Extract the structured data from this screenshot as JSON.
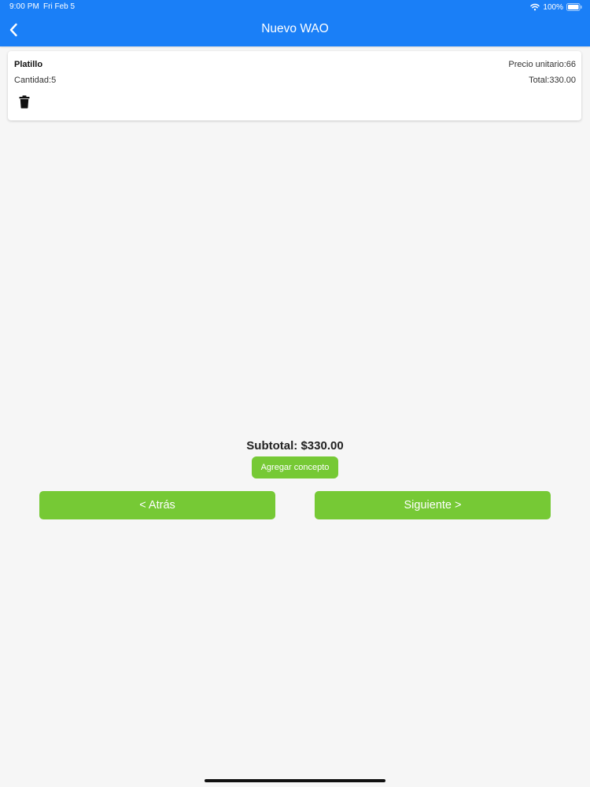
{
  "status_bar": {
    "time": "9:00 PM",
    "date": "Fri Feb 5",
    "battery": "100%",
    "icons": [
      "wifi-icon",
      "battery-icon"
    ]
  },
  "nav": {
    "title": "Nuevo WAO",
    "back_icon": "chevron-left-icon"
  },
  "item": {
    "name": "Platillo",
    "quantity": "Cantidad:5",
    "unit_price": "Precio unitario:66",
    "total": "Total:330.00",
    "delete_icon": "trash-icon"
  },
  "summary": {
    "subtotal": "Subtotal: $330.00",
    "add_label": "Agregar concepto"
  },
  "footer": {
    "back_label": "< Atrás",
    "next_label": "Siguiente >"
  },
  "colors": {
    "header": "#1a7ff7",
    "accent_green": "#76c935",
    "background": "#f6f6f6"
  }
}
